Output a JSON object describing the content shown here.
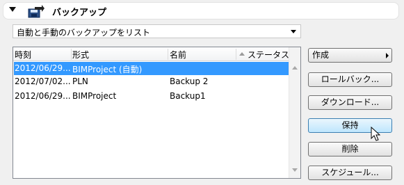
{
  "section": {
    "title": "バックアップ",
    "expand_icon": "triangle-down-icon",
    "icon": "backup-icon"
  },
  "filter": {
    "selected": "自動と手動のバックアップをリスト"
  },
  "table": {
    "columns": {
      "time": "時刻",
      "format": "形式",
      "name": "名前",
      "status": "ステータス"
    },
    "sort": {
      "column": "status",
      "direction": "ascending"
    },
    "rows": [
      {
        "time": "2012/06/29...",
        "format": "BIMProject (自動)",
        "name": "",
        "status": "",
        "selected": true
      },
      {
        "time": "2012/07/02...",
        "format": "PLN",
        "name": "Backup 2",
        "status": "",
        "selected": false
      },
      {
        "time": "2012/06/29...",
        "format": "BIMProject",
        "name": "Backup1",
        "status": "",
        "selected": false
      }
    ]
  },
  "buttons": {
    "create": "作成",
    "rollback": "ロールバック...",
    "download": "ダウンロード...",
    "keep": "保持",
    "delete": "削除",
    "schedule": "スケジュール..."
  },
  "colors": {
    "selection": "#3399ff",
    "hover_button": "#bee6fd"
  }
}
